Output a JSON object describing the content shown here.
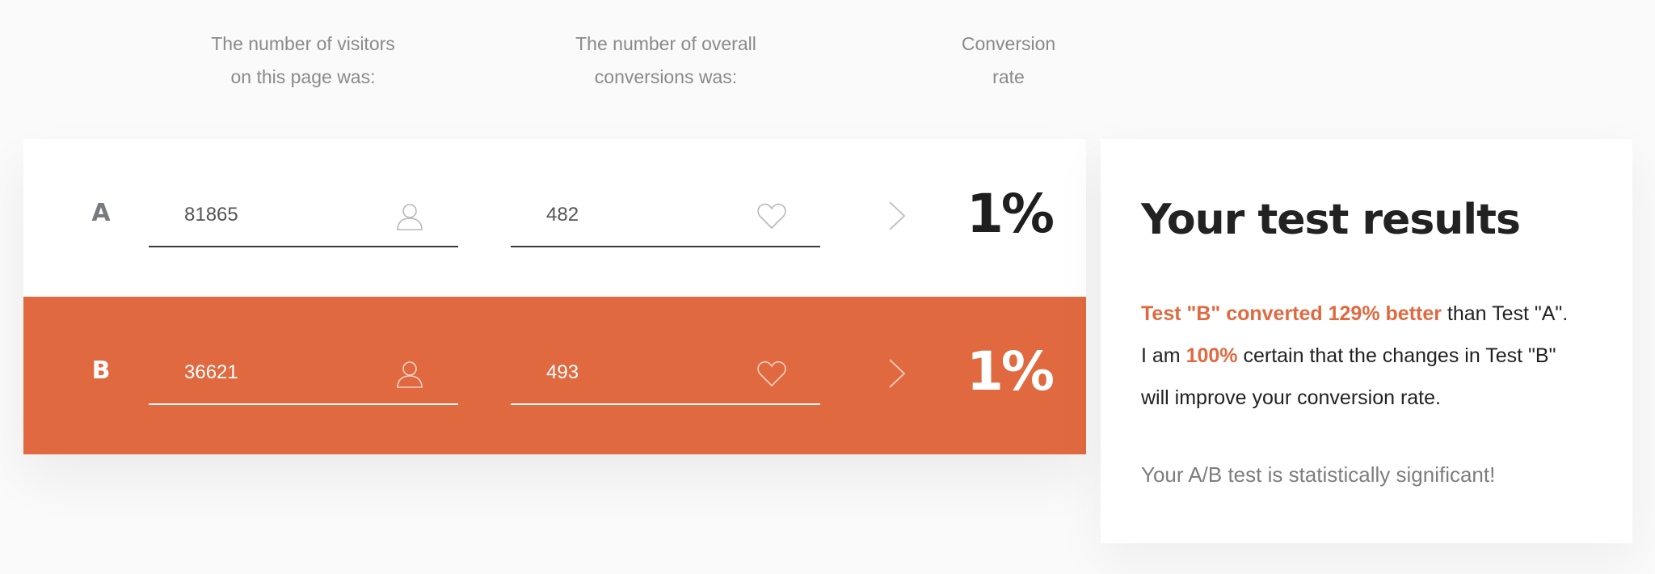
{
  "headers": {
    "visitors": [
      "The number of visitors",
      "on this page was:"
    ],
    "conversions": [
      "The number of overall",
      "conversions was:"
    ],
    "rate": [
      "Conversion",
      "rate"
    ]
  },
  "rows": [
    {
      "label": "A",
      "visitors": "81865",
      "conversions": "482",
      "rate": "1%"
    },
    {
      "label": "B",
      "visitors": "36621",
      "conversions": "493",
      "rate": "1%"
    }
  ],
  "icons": {
    "visitors": "user-icon",
    "conversions": "heart-icon",
    "arrow": "chevron-right-icon"
  },
  "colors": {
    "accent": "#e06940",
    "text_dark": "#222222",
    "text_muted": "#8a8a8a"
  },
  "results": {
    "title": "Your test results",
    "line1_highlight": "Test \"B\" converted 129% better",
    "line1_rest": " than Test \"A\".",
    "line2_pre": "I am ",
    "line2_highlight": "100%",
    "line2_rest": " certain that the changes in Test \"B\"",
    "line3": "will improve your conversion rate.",
    "note": "Your A/B test is statistically significant!"
  }
}
